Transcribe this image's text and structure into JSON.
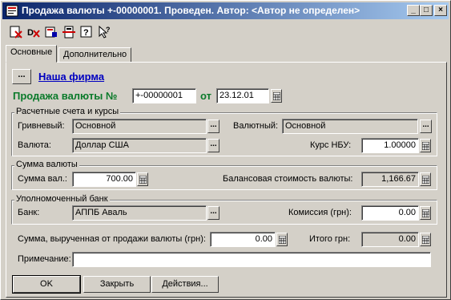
{
  "window": {
    "title": "Продажа валюты +-00000001. Проведен. Автор: <Автор не определен>",
    "controls": [
      "_",
      "□",
      "×"
    ]
  },
  "toolbar": {
    "items": [
      {
        "icon": "delete-mark-icon"
      },
      {
        "icon": "delete-icon"
      },
      {
        "icon": "post-icon"
      },
      {
        "icon": "structure-icon"
      },
      {
        "icon": "help-icon"
      },
      {
        "icon": "context-help-icon"
      }
    ]
  },
  "tabs": [
    {
      "label": "Основные",
      "active": true
    },
    {
      "label": "Дополнительно",
      "active": false
    }
  ],
  "header": {
    "firm_button": "...",
    "firm_link": "Наша фирма",
    "doc_label": "Продажа валюты №",
    "doc_number": "+-00000001",
    "date_label": "от",
    "date_value": "23.12.01"
  },
  "accounts": {
    "title": "Расчетные счета и курсы",
    "uah_label": "Гривневый:",
    "uah_value": "Основной",
    "fx_label": "Валютный:",
    "fx_value": "Основной",
    "currency_label": "Валюта:",
    "currency_value": "Доллар США",
    "rate_label": "Курс НБУ:",
    "rate_value": "1.00000"
  },
  "sum": {
    "title": "Сумма валюты",
    "sum_label": "Сумма вал.:",
    "sum_value": "700.00",
    "balance_label": "Балансовая стоимость валюты:",
    "balance_value": "1,166.67"
  },
  "bank": {
    "title": "Уполномоченный банк",
    "bank_label": "Банк:",
    "bank_value": "АППБ Аваль",
    "fee_label": "Комиссия (грн):",
    "fee_value": "0.00"
  },
  "proceeds": {
    "label": "Сумма, вырученная от продажи валюты (грн):",
    "value": "0.00",
    "total_label": "Итого грн:",
    "total_value": "0.00"
  },
  "note": {
    "label": "Примечание:",
    "value": ""
  },
  "buttons": {
    "ok": "OK",
    "close": "Закрыть",
    "actions": "Действия..."
  }
}
